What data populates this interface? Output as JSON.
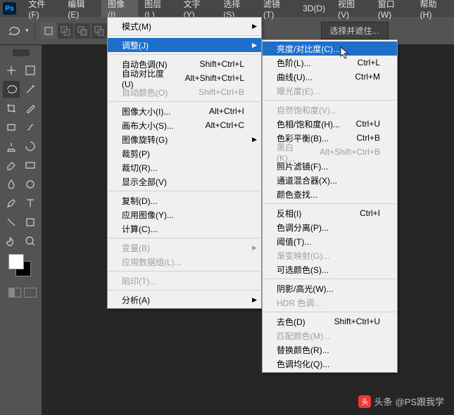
{
  "menubar": {
    "items": [
      "文件(F)",
      "编辑(E)",
      "图像(I)",
      "图层(L)",
      "文字(Y)",
      "选择(S)",
      "滤镜(T)",
      "3D(D)",
      "视图(V)",
      "窗口(W)",
      "帮助(H)"
    ],
    "active_index": 2
  },
  "toolbar": {
    "mask_button": "选择并遮住..."
  },
  "image_menu": [
    {
      "label": "模式(M)",
      "sub": true
    },
    {
      "div": true
    },
    {
      "label": "调整(J)",
      "sub": true,
      "hi": true
    },
    {
      "div": true
    },
    {
      "label": "自动色调(N)",
      "sc": "Shift+Ctrl+L"
    },
    {
      "label": "自动对比度(U)",
      "sc": "Alt+Shift+Ctrl+L"
    },
    {
      "label": "自动颜色(O)",
      "sc": "Shift+Ctrl+B",
      "disabled": true
    },
    {
      "div": true
    },
    {
      "label": "图像大小(I)...",
      "sc": "Alt+Ctrl+I"
    },
    {
      "label": "画布大小(S)...",
      "sc": "Alt+Ctrl+C"
    },
    {
      "label": "图像旋转(G)",
      "sub": true
    },
    {
      "label": "裁剪(P)"
    },
    {
      "label": "裁切(R)..."
    },
    {
      "label": "显示全部(V)"
    },
    {
      "div": true
    },
    {
      "label": "复制(D)..."
    },
    {
      "label": "应用图像(Y)..."
    },
    {
      "label": "计算(C)..."
    },
    {
      "div": true
    },
    {
      "label": "变量(B)",
      "sub": true,
      "disabled": true
    },
    {
      "label": "应用数据组(L)...",
      "disabled": true
    },
    {
      "div": true
    },
    {
      "label": "陷印(T)...",
      "disabled": true
    },
    {
      "div": true
    },
    {
      "label": "分析(A)",
      "sub": true
    }
  ],
  "adjust_menu": [
    {
      "label": "亮度/对比度(C)...",
      "hi": true
    },
    {
      "label": "色阶(L)...",
      "sc": "Ctrl+L"
    },
    {
      "label": "曲线(U)...",
      "sc": "Ctrl+M"
    },
    {
      "label": "曝光度(E)...",
      "disabled": true
    },
    {
      "div": true
    },
    {
      "label": "自然饱和度(V)...",
      "disabled": true
    },
    {
      "label": "色相/饱和度(H)...",
      "sc": "Ctrl+U"
    },
    {
      "label": "色彩平衡(B)...",
      "sc": "Ctrl+B"
    },
    {
      "label": "黑白(K)...",
      "sc": "Alt+Shift+Ctrl+B",
      "disabled": true
    },
    {
      "label": "照片滤镜(F)..."
    },
    {
      "label": "通道混合器(X)..."
    },
    {
      "label": "颜色查找..."
    },
    {
      "div": true
    },
    {
      "label": "反相(I)",
      "sc": "Ctrl+I"
    },
    {
      "label": "色调分离(P)..."
    },
    {
      "label": "阈值(T)..."
    },
    {
      "label": "渐变映射(G)...",
      "disabled": true
    },
    {
      "label": "可选颜色(S)..."
    },
    {
      "div": true
    },
    {
      "label": "阴影/高光(W)..."
    },
    {
      "label": "HDR 色调...",
      "disabled": true
    },
    {
      "div": true
    },
    {
      "label": "去色(D)",
      "sc": "Shift+Ctrl+U"
    },
    {
      "label": "匹配颜色(M)...",
      "disabled": true
    },
    {
      "label": "替换颜色(R)..."
    },
    {
      "label": "色调均化(Q)..."
    }
  ],
  "watermark": {
    "text": "@PS跟我学",
    "prefix": "头条"
  }
}
